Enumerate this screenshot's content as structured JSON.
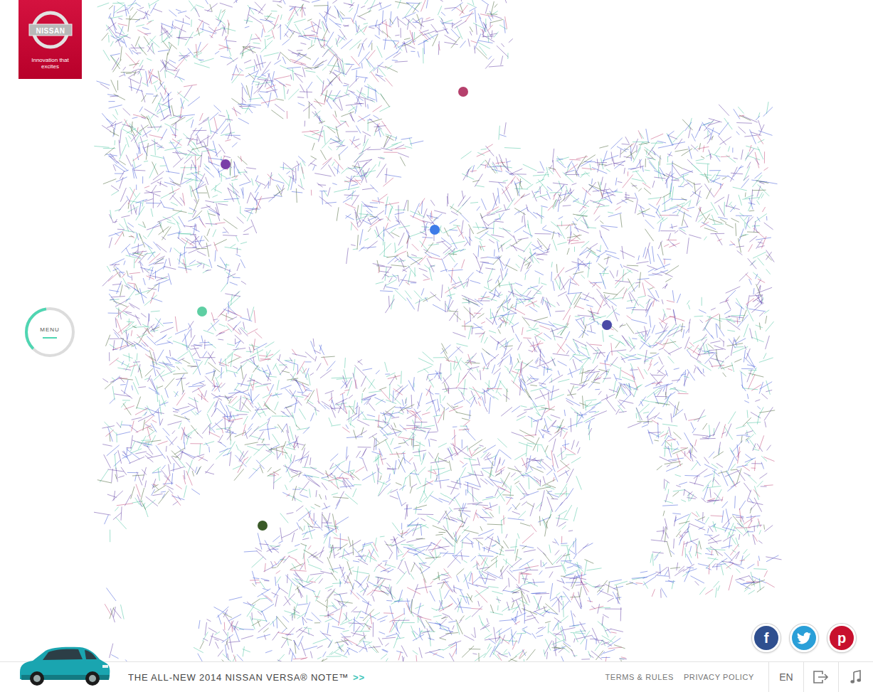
{
  "logo": {
    "brand": "NISSAN",
    "tagline": "Innovation that excites"
  },
  "menu": {
    "label": "MENU",
    "level": 0.35
  },
  "pins": [
    {
      "color": "#b5406c"
    },
    {
      "color": "#7a3fa8"
    },
    {
      "color": "#3d7be8"
    },
    {
      "color": "#5ecfa3"
    },
    {
      "color": "#4a4aa6"
    },
    {
      "color": "#3a5a28"
    }
  ],
  "social": [
    {
      "kind": "facebook",
      "glyph": "f",
      "color": "#2f4f8f"
    },
    {
      "kind": "twitter",
      "color": "#2a9fd8"
    },
    {
      "kind": "pinterest",
      "glyph": "p",
      "color": "#c8102e"
    }
  ],
  "footer": {
    "promo": "THE ALL-NEW 2014 NISSAN VERSA® NOTE™",
    "promo_arrow": ">>",
    "links": [
      "TERMS & RULES",
      "PRIVACY POLICY"
    ],
    "language": "EN"
  }
}
